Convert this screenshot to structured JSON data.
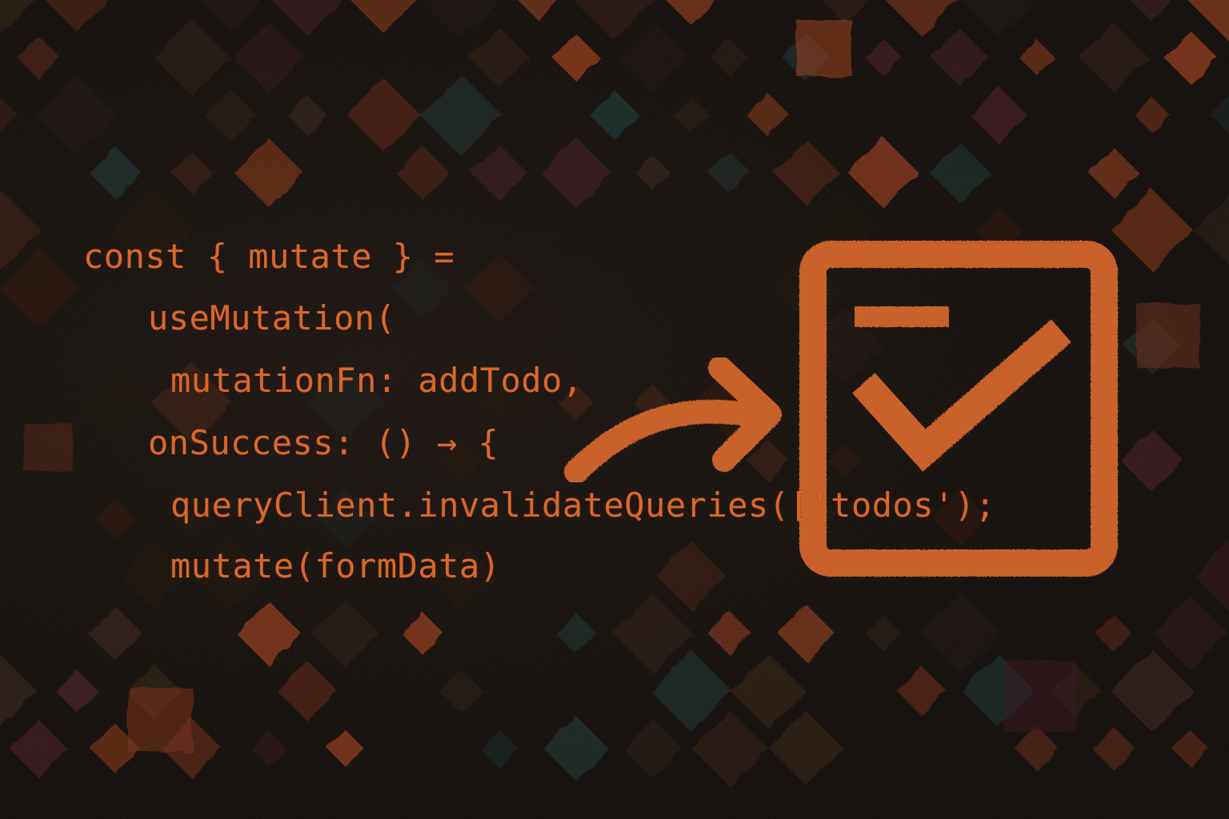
{
  "code": {
    "lines": [
      "const { mutate } =",
      "useMutation(",
      "mutationFn: addTodo,",
      "onSuccess: () → {",
      "queryClient.invalidateQueries(['todos');",
      "mutate(formData)"
    ]
  },
  "colors": {
    "accent": "#d8692a",
    "background": "#1a120e",
    "tile_orange": "#b8471c",
    "tile_teal": "#1f3a38",
    "tile_plum": "#4a1f28"
  },
  "icons": [
    "arrow-icon",
    "checkbox-icon"
  ]
}
